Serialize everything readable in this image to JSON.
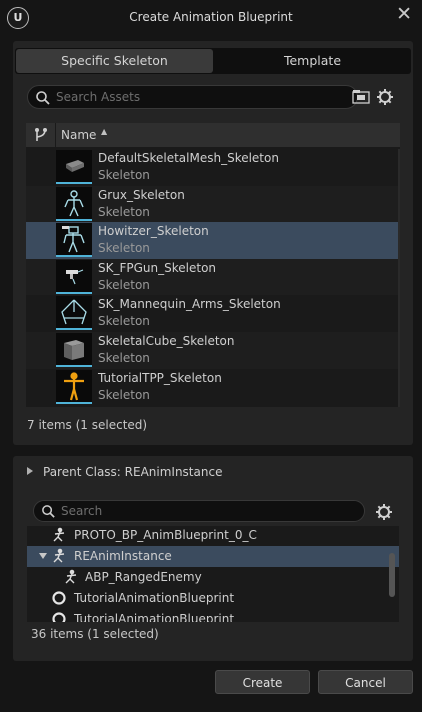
{
  "window": {
    "title": "Create Animation Blueprint",
    "logo_text": "U"
  },
  "tabs": [
    {
      "label": "Specific Skeleton",
      "active": true
    },
    {
      "label": "Template",
      "active": false
    }
  ],
  "asset_search": {
    "placeholder": "Search Assets"
  },
  "table": {
    "column_name": "Name",
    "rows": [
      {
        "name": "DefaultSkeletalMesh_Skeleton",
        "type": "Skeleton",
        "thumb": "box-mesh",
        "selected": false
      },
      {
        "name": "Grux_Skeleton",
        "type": "Skeleton",
        "thumb": "creature",
        "selected": false
      },
      {
        "name": "Howitzer_Skeleton",
        "type": "Skeleton",
        "thumb": "robot",
        "selected": true
      },
      {
        "name": "SK_FPGun_Skeleton",
        "type": "Skeleton",
        "thumb": "gun",
        "selected": false
      },
      {
        "name": "SK_Mannequin_Arms_Skeleton",
        "type": "Skeleton",
        "thumb": "arms",
        "selected": false
      },
      {
        "name": "SkeletalCube_Skeleton",
        "type": "Skeleton",
        "thumb": "cube",
        "selected": false
      },
      {
        "name": "TutorialTPP_Skeleton",
        "type": "Skeleton",
        "thumb": "mannequin",
        "selected": false
      }
    ],
    "count_text": "7 items (1 selected)"
  },
  "parent_class": {
    "header": "Parent Class: REAnimInstance",
    "search_placeholder": "Search",
    "items": [
      {
        "label": "PROTO_BP_AnimBlueprint_0_C",
        "icon": "anim-class-icon",
        "indent": 1,
        "selected": false
      },
      {
        "label": "REAnimInstance",
        "icon": "anim-class-icon",
        "indent": 1,
        "expanded": true,
        "selected": true
      },
      {
        "label": "ABP_RangedEnemy",
        "icon": "anim-class-icon",
        "indent": 2,
        "selected": false
      },
      {
        "label": "TutorialAnimationBlueprint",
        "icon": "circle-class-icon",
        "indent": 1,
        "selected": false
      },
      {
        "label": "TutorialAnimationBlueprint",
        "icon": "circle-class-icon",
        "indent": 1,
        "selected": false
      }
    ],
    "count_text": "36 items (1 selected)"
  },
  "buttons": {
    "create": "Create",
    "cancel": "Cancel"
  },
  "colors": {
    "selection": "#3b4b5e",
    "thumb_accent": "#4fb3d8",
    "background": "#151515",
    "panel": "#242424"
  }
}
